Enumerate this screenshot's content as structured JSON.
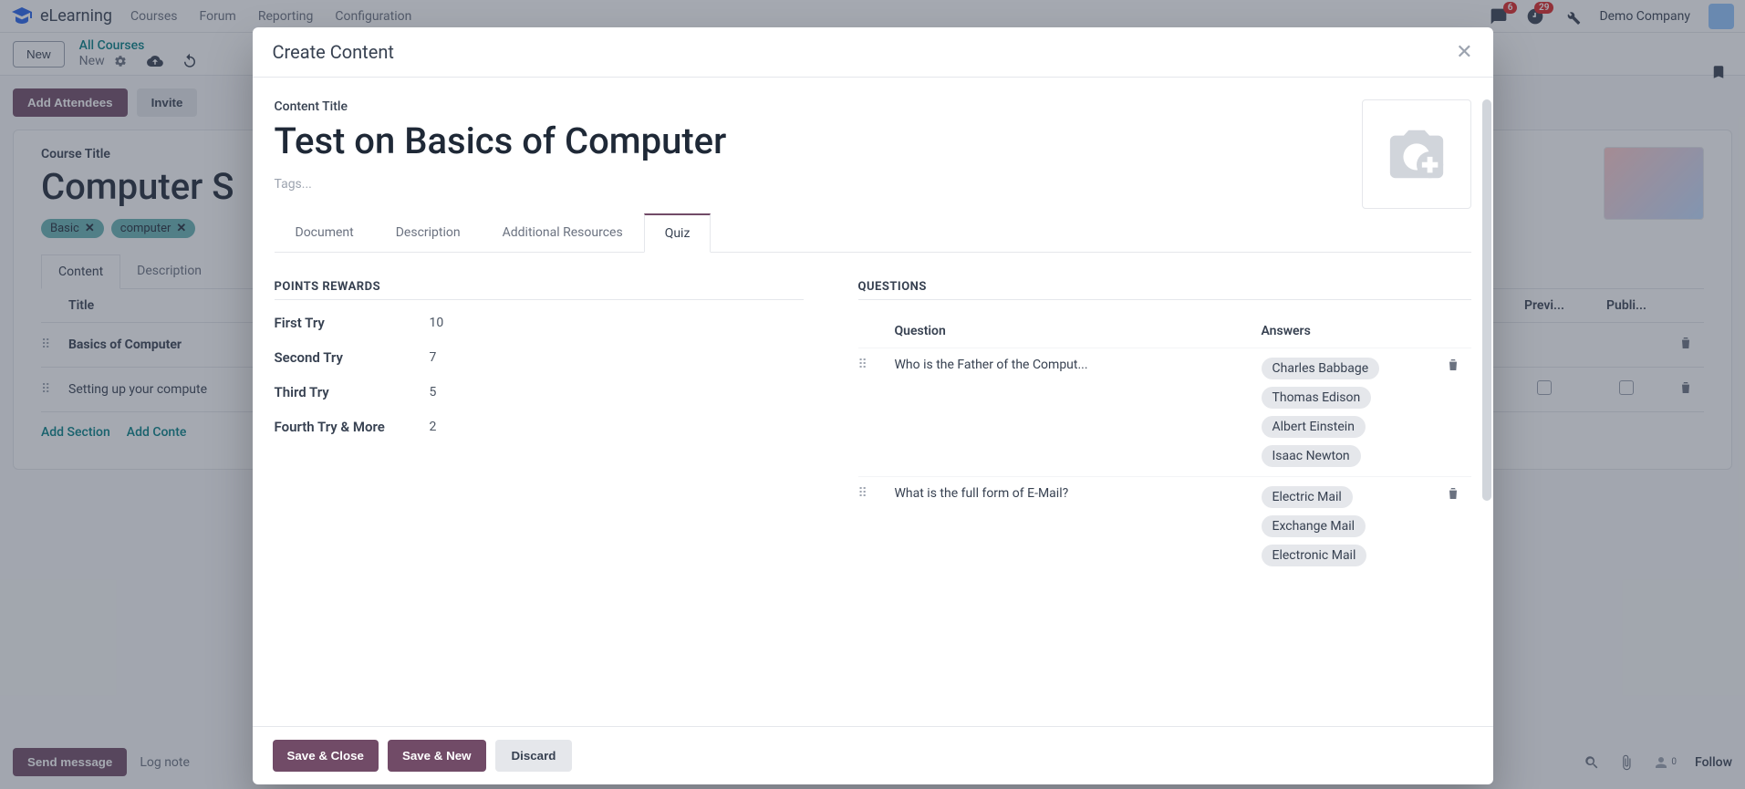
{
  "brand": "eLearning",
  "nav": [
    "Courses",
    "Forum",
    "Reporting",
    "Configuration"
  ],
  "company": "Demo Company",
  "badges": {
    "messages": "6",
    "activities": "29"
  },
  "subnav": {
    "new": "New",
    "breadcrumb1": "All Courses",
    "breadcrumb2": "New"
  },
  "actions": {
    "add_attendees": "Add Attendees",
    "invite": "Invite"
  },
  "course": {
    "title_label": "Course Title",
    "title": "Computer S",
    "tags": [
      "Basic",
      "computer"
    ],
    "tabs": [
      "Content",
      "Description"
    ],
    "columns": {
      "title": "Title",
      "preview": "Previ...",
      "published": "Publi..."
    },
    "sections": [
      {
        "title": "Basics of Computer",
        "is_section": true
      },
      {
        "title": "Setting up your compute",
        "is_section": false
      }
    ],
    "add_section": "Add Section",
    "add_content": "Add Conte"
  },
  "bottom": {
    "send": "Send message",
    "log": "Log note",
    "follow": "Follow",
    "followers": "0"
  },
  "modal": {
    "title": "Create Content",
    "content_title_label": "Content Title",
    "content_title": "Test on Basics of Computer",
    "tags_placeholder": "Tags...",
    "tabs": [
      "Document",
      "Description",
      "Additional Resources",
      "Quiz"
    ],
    "active_tab": 3,
    "points": {
      "section": "POINTS REWARDS",
      "rows": [
        {
          "label": "First Try",
          "val": "10"
        },
        {
          "label": "Second Try",
          "val": "7"
        },
        {
          "label": "Third Try",
          "val": "5"
        },
        {
          "label": "Fourth Try & More",
          "val": "2"
        }
      ]
    },
    "questions": {
      "section": "QUESTIONS",
      "col_question": "Question",
      "col_answers": "Answers",
      "rows": [
        {
          "q": "Who is the Father of the Comput...",
          "answers": [
            "Charles Babbage",
            "Thomas Edison",
            "Albert Einstein",
            "Isaac Newton"
          ]
        },
        {
          "q": "What is the full form of E-Mail?",
          "answers": [
            "Electric Mail",
            "Exchange Mail",
            "Electronic Mail"
          ]
        }
      ]
    },
    "footer": {
      "save_close": "Save & Close",
      "save_new": "Save & New",
      "discard": "Discard"
    }
  }
}
